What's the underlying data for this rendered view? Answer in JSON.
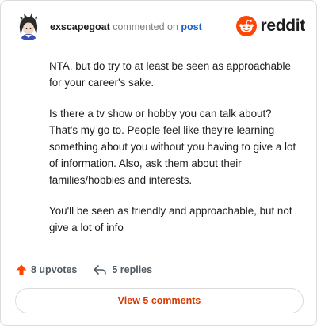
{
  "comment": {
    "username": "exscapegoat",
    "action_text": "commented on",
    "post_link_text": "post",
    "paragraphs": [
      "NTA, but do try to at least be seen as approachable for your career's sake.",
      "Is there a tv show or hobby you can talk about? That's my go to. People feel like they're learning something about you without you having to give a lot of information. Also, ask them about their families/hobbies and interests.",
      "You'll be seen as friendly and approachable, but not give a lot of info"
    ]
  },
  "brand": {
    "name": "reddit",
    "color": "#ff4500",
    "icon": "reddit-snoo-icon"
  },
  "footer": {
    "upvotes_label": "8 upvotes",
    "replies_label": "5 replies",
    "upvote_icon": "upvote-arrow-icon",
    "reply_icon": "reply-arrow-icon",
    "upvote_color": "#ff4500"
  },
  "view_button": {
    "label": "View 5 comments",
    "color": "#d93a00"
  }
}
